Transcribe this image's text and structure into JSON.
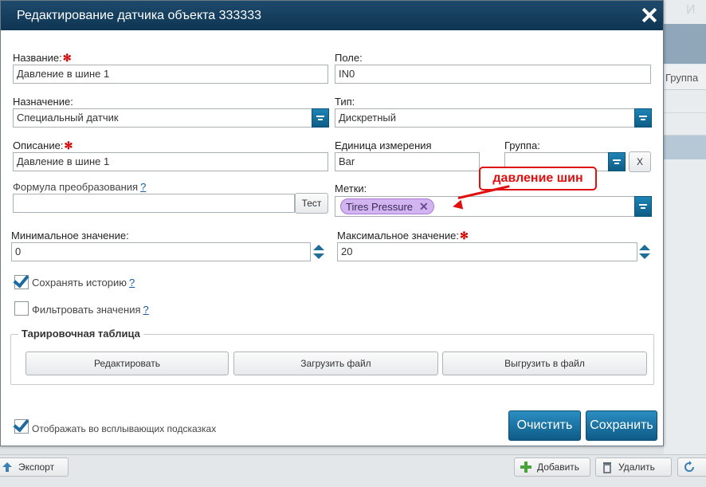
{
  "dialog": {
    "title": "Редактирование датчика объекта 333333",
    "name": {
      "label": "Название:",
      "value": "Давление в шине 1"
    },
    "field": {
      "label": "Поле:",
      "value": "IN0"
    },
    "purpose": {
      "label": "Назначение:",
      "value": "Специальный датчик"
    },
    "type": {
      "label": "Тип:",
      "value": "Дискретный"
    },
    "description": {
      "label": "Описание:",
      "value": "Давление в шине 1"
    },
    "unit": {
      "label": "Единица измерения",
      "value": "Bar"
    },
    "group": {
      "label": "Группа:",
      "value": "",
      "clear": "X"
    },
    "formula": {
      "label": "Формула преобразования",
      "help": "?",
      "value": "",
      "test_button": "Тест"
    },
    "tags": {
      "label": "Метки:",
      "items": [
        {
          "label": "Tires Pressure"
        }
      ]
    },
    "min": {
      "label": "Минимальное значение:",
      "value": "0"
    },
    "max": {
      "label": "Максимальное значение:",
      "value": "20"
    },
    "save_history": {
      "label": "Сохранять историю",
      "help": "?",
      "checked": true
    },
    "filter_values": {
      "label": "Фильтровать значения",
      "help": "?",
      "checked": false
    },
    "calibration": {
      "legend": "Тарировочная таблица",
      "edit": "Редактировать",
      "upload": "Загрузить файл",
      "download": "Выгрузить в файл"
    },
    "show_tooltips": {
      "label": "Отображать во всплывающих подсказках",
      "checked": true
    },
    "clear_button": "Очистить",
    "save_button": "Сохранить"
  },
  "annotation": {
    "text": "давление шин",
    "color": "#e01010"
  },
  "background": {
    "column_header": "Группа",
    "export_button": "Экспорт",
    "add_button": "Добавить",
    "delete_button": "Удалить",
    "right_partial": "И"
  },
  "colors": {
    "titlebar": "#0e3552",
    "accent": "#0d5d86",
    "required": "#d10000",
    "tag": "#d2b4f0"
  }
}
